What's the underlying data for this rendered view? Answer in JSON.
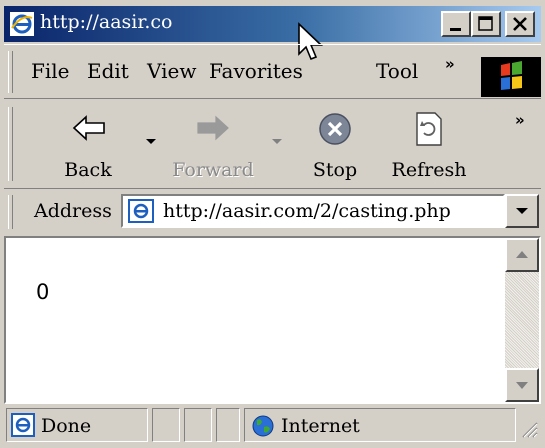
{
  "window": {
    "title": "http://aasir.co"
  },
  "menu": {
    "file": "File",
    "edit": "Edit",
    "view": "View",
    "favorites": "Favorites",
    "tools": "Tool",
    "more": "»"
  },
  "toolbar": {
    "back": "Back",
    "forward": "Forward",
    "stop": "Stop",
    "refresh": "Refresh",
    "more": "»"
  },
  "address": {
    "label": "Address",
    "url": "http://aasir.com/2/casting.php"
  },
  "content": {
    "text": "0"
  },
  "status": {
    "text": "Done",
    "zone": "Internet"
  },
  "colors": {
    "title_start": "#0a246a",
    "title_end": "#a6caf0",
    "chrome": "#d4d0c8"
  }
}
